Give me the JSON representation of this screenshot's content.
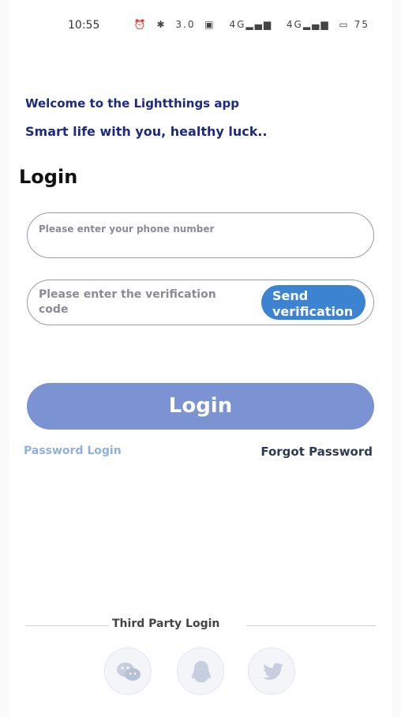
{
  "status_bar": {
    "time": "10:55",
    "icons": [
      "alarm-icon",
      "bluetooth-icon",
      "data-speed-icon",
      "nfc-icon",
      "signal-icon",
      "signal-icon",
      "battery-icon"
    ],
    "speed_text": "3.0",
    "signal1_text": "4G",
    "signal2_text": "4G",
    "battery_text": "75"
  },
  "header": {
    "welcome": "Welcome to the Lightthings app",
    "tagline": "Smart life with you, healthy luck.."
  },
  "login": {
    "title": "Login",
    "phone_placeholder": "Please enter your phone number",
    "code_placeholder": "Please enter the verification code",
    "send_button": "Send verification",
    "login_button": "Login",
    "password_login": "Password Login",
    "forgot_password": "Forgot Password"
  },
  "third_party": {
    "label": "Third Party Login",
    "options": [
      "wechat-icon",
      "qq-icon",
      "twitter-icon"
    ]
  },
  "colors": {
    "accent_dark": "#1c2a84",
    "send_button": "#3c83d2",
    "login_button": "#7b93d3",
    "link_light": "#8fb0e6",
    "social_icon": "#c7cfdf"
  }
}
